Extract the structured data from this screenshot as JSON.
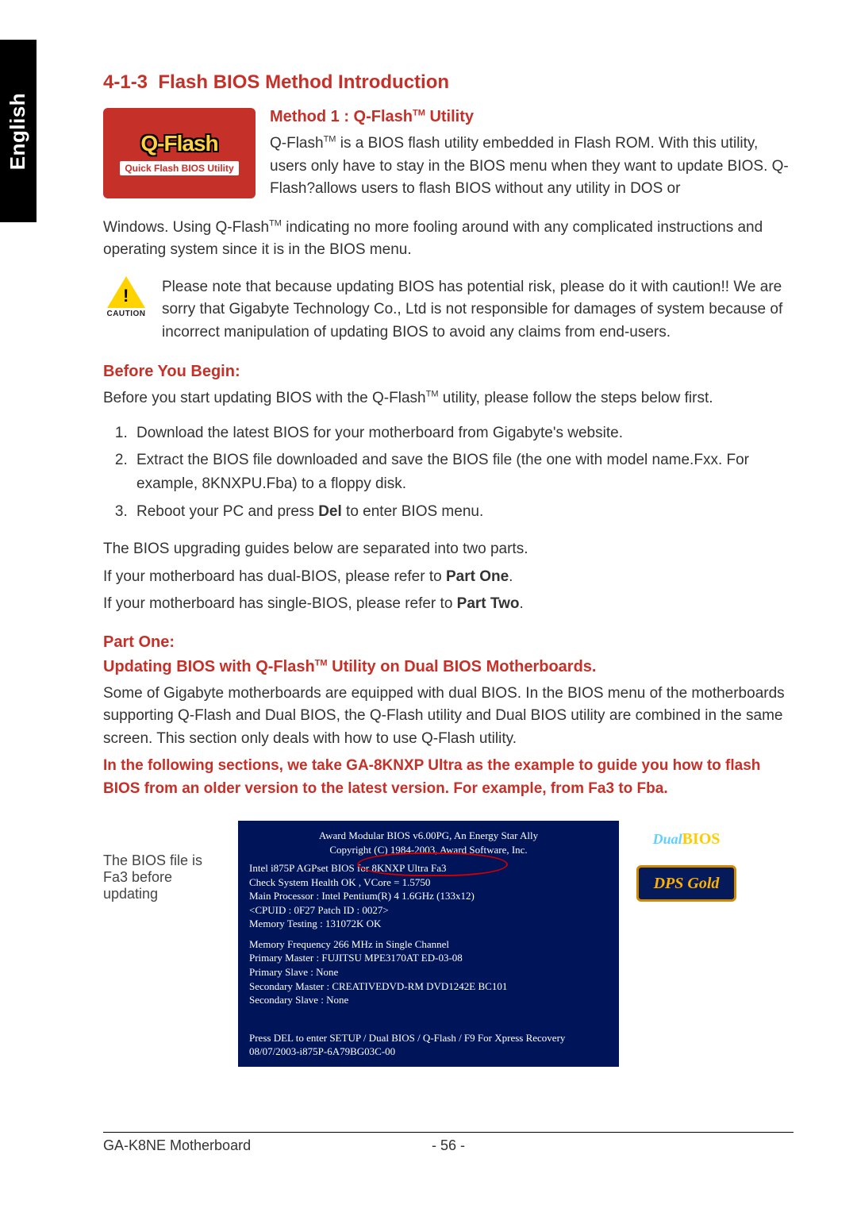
{
  "lang_tab": "English",
  "section_number": "4-1-3",
  "section_title": "Flash BIOS Method Introduction",
  "method1_heading_pre": "Method 1 : Q-Flash",
  "method1_heading_post": " Utility",
  "qflash_logo_main": "Q-Flash",
  "qflash_logo_sub": "Quick Flash BIOS Utility",
  "intro_para_1a": "Q-Flash",
  "intro_para_1b": " is a BIOS flash utility embedded in Flash ROM. With this utility, users only have to stay in the BIOS menu when they want to update BIOS. Q-Flash?allows users to flash BIOS without any utility in DOS or",
  "intro_para_2a": "Windows. Using Q-Flash",
  "intro_para_2b": " indicating no more fooling around with any complicated instructions and operating system since it is in the BIOS menu.",
  "caution_label": "CAUTION",
  "caution_text": "Please note that because updating BIOS has potential risk, please do it with caution!! We are sorry that Gigabyte Technology Co., Ltd is not responsible for damages of system because of incorrect manipulation of updating BIOS to avoid any claims from end-users.",
  "before_begin_head": "Before You Begin:",
  "before_begin_intro_a": "Before you start updating BIOS with the Q-Flash",
  "before_begin_intro_b": " utility, please follow the steps below first.",
  "steps": [
    {
      "text_a": "Download the latest BIOS for your motherboard from Gigabyte's website."
    },
    {
      "text_a": "Extract the BIOS file downloaded and save the BIOS file (the one with model name.Fxx. For example, 8KNXPU.Fba) to a floppy disk."
    },
    {
      "text_a": "Reboot your PC and press ",
      "bold": "Del",
      "text_b": " to enter BIOS menu."
    }
  ],
  "guides_line1": "The BIOS upgrading guides below are separated into two parts.",
  "guides_line2_a": "If your motherboard has dual-BIOS, please refer to ",
  "guides_line2_b": "Part One",
  "guides_line2_c": ".",
  "guides_line3_a": "If your motherboard has single-BIOS, please refer to ",
  "guides_line3_b": "Part Two",
  "guides_line3_c": ".",
  "part_one_head": "Part One:",
  "part_one_sub_a": "Updating BIOS with Q-Flash",
  "part_one_sub_b": " Utility on Dual BIOS Motherboards.",
  "part_one_desc": "Some of Gigabyte motherboards are equipped with dual BIOS. In the BIOS menu of the motherboards supporting Q-Flash and Dual BIOS, the Q-Flash utility and Dual BIOS utility are combined in the same screen. This section only deals with how to use Q-Flash utility.",
  "part_one_bold": "In the following sections, we take GA-8KNXP Ultra as the example to guide you how to flash BIOS from an older version to the latest version. For example, from Fa3 to Fba.",
  "shot_note": "The BIOS file is Fa3 before updating",
  "bios": {
    "l1": "Award Modular BIOS v6.00PG, An Energy Star Ally",
    "l2": "Copyright (C) 1984-2003, Award Software, Inc.",
    "l3": "Intel i875P AGPset BIOS for 8KNXP Ultra Fa3",
    "l4": "Check System Health OK , VCore = 1.5750",
    "l5": "Main Processor : Intel Pentium(R) 4  1.6GHz (133x12)",
    "l6": "<CPUID : 0F27 Patch ID : 0027>",
    "l7": "Memory Testing : 131072K OK",
    "l8": "Memory Frequency 266 MHz in Single Channel",
    "l9": "Primary Master : FUJITSU MPE3170AT ED-03-08",
    "l10": "Primary Slave : None",
    "l11": "Secondary Master : CREATIVEDVD-RM DVD1242E BC101",
    "l12": "Secondary Slave : None",
    "l13": "Press DEL to enter SETUP / Dual BIOS / Q-Flash / F9 For Xpress Recovery",
    "l14": "08/07/2003-i875P-6A79BG03C-00"
  },
  "badge_dual_a": "Dual",
  "badge_dual_b": "BIOS",
  "badge_dps": "DPS Gold",
  "footer_left": "GA-K8NE Motherboard",
  "footer_page": "- 56 -"
}
